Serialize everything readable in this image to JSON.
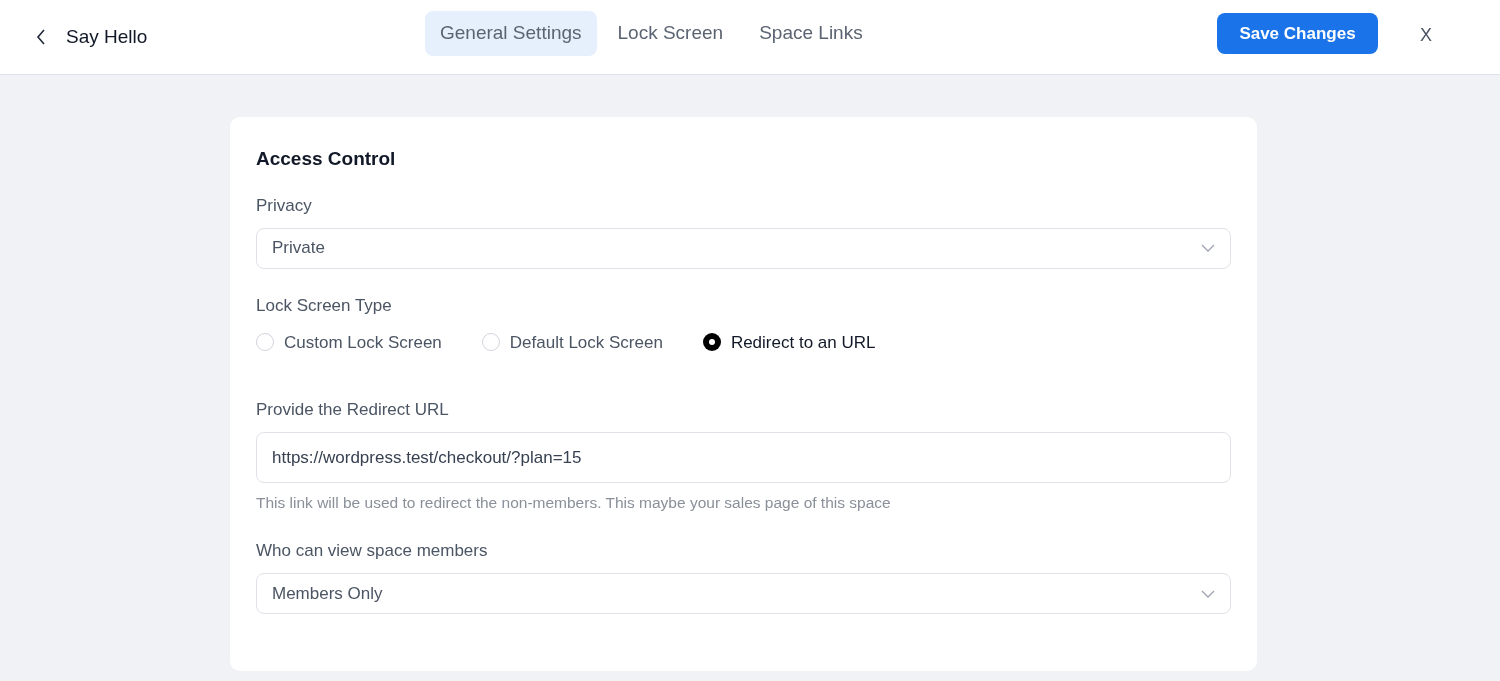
{
  "header": {
    "title": "Say Hello",
    "save_button": "Save Changes",
    "close": "X"
  },
  "tabs": [
    {
      "label": "General Settings",
      "selected": true
    },
    {
      "label": "Lock Screen",
      "selected": false
    },
    {
      "label": "Space Links",
      "selected": false
    }
  ],
  "card": {
    "title": "Access Control",
    "privacy": {
      "label": "Privacy",
      "value": "Private"
    },
    "lock_screen_type": {
      "label": "Lock Screen Type",
      "options": [
        {
          "label": "Custom Lock Screen",
          "selected": false
        },
        {
          "label": "Default Lock Screen",
          "selected": false
        },
        {
          "label": "Redirect to an URL",
          "selected": true
        }
      ]
    },
    "redirect_url": {
      "label": "Provide the Redirect URL",
      "value": "https://wordpress.test/checkout/?plan=15",
      "help": "This link will be used to redirect the non-members. This maybe your sales page of this space"
    },
    "view_members": {
      "label": "Who can view space members",
      "value": "Members Only"
    }
  }
}
